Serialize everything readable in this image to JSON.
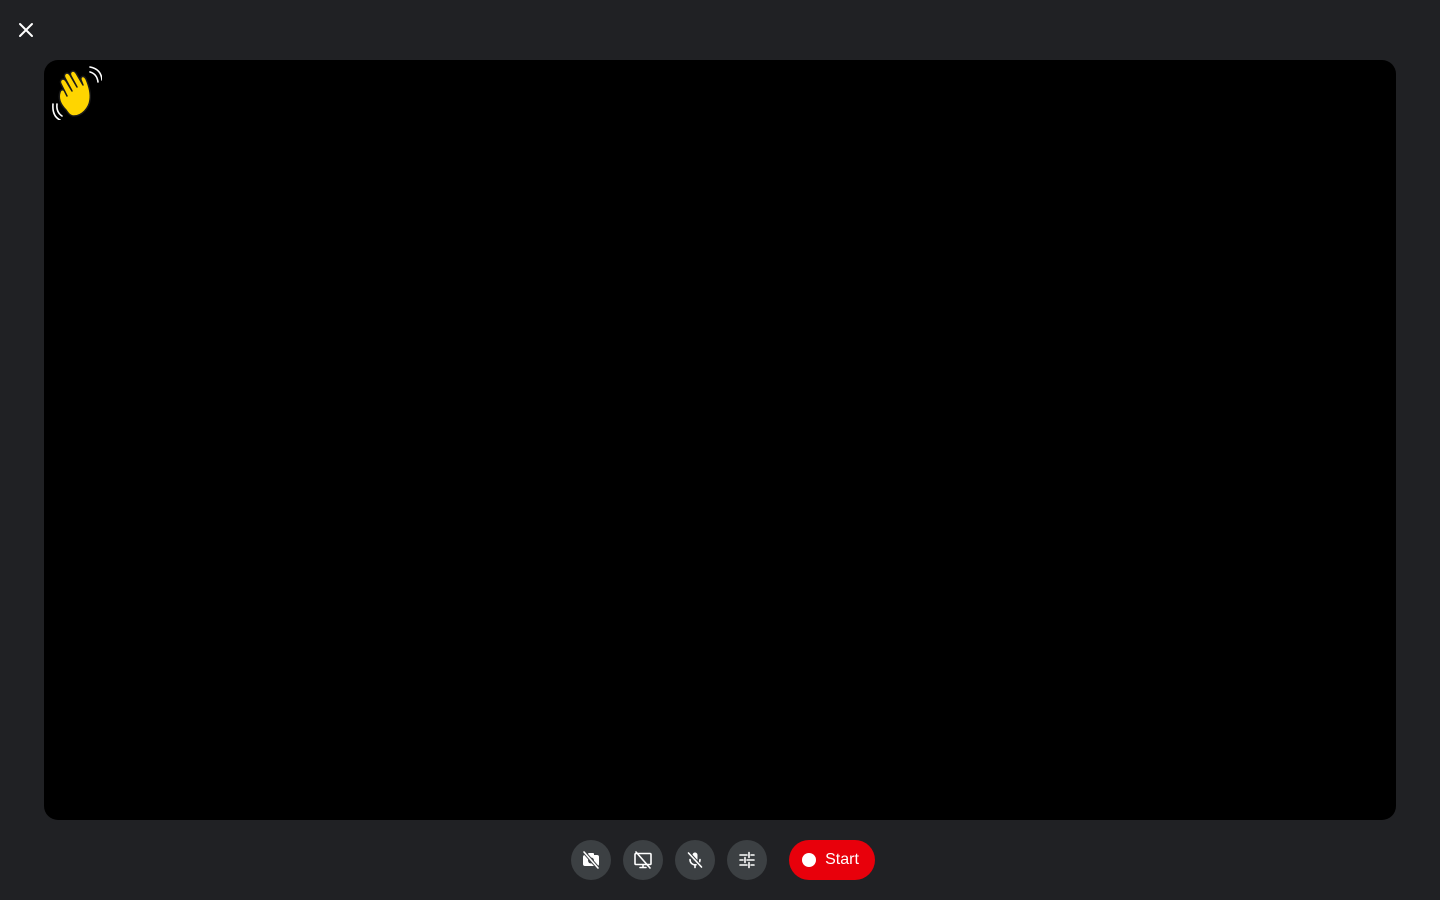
{
  "window": {
    "close_icon": "close-icon"
  },
  "preview": {
    "logo_icon": "waving-hand-icon"
  },
  "controls": {
    "camera_icon": "camera-off-icon",
    "screen_icon": "screen-share-off-icon",
    "mic_icon": "mic-off-icon",
    "settings_icon": "sliders-icon",
    "start_label": "Start"
  },
  "colors": {
    "background": "#202124",
    "preview": "#000000",
    "button": "#3c4043",
    "record": "#e8000b",
    "logo": "#ffd500"
  }
}
